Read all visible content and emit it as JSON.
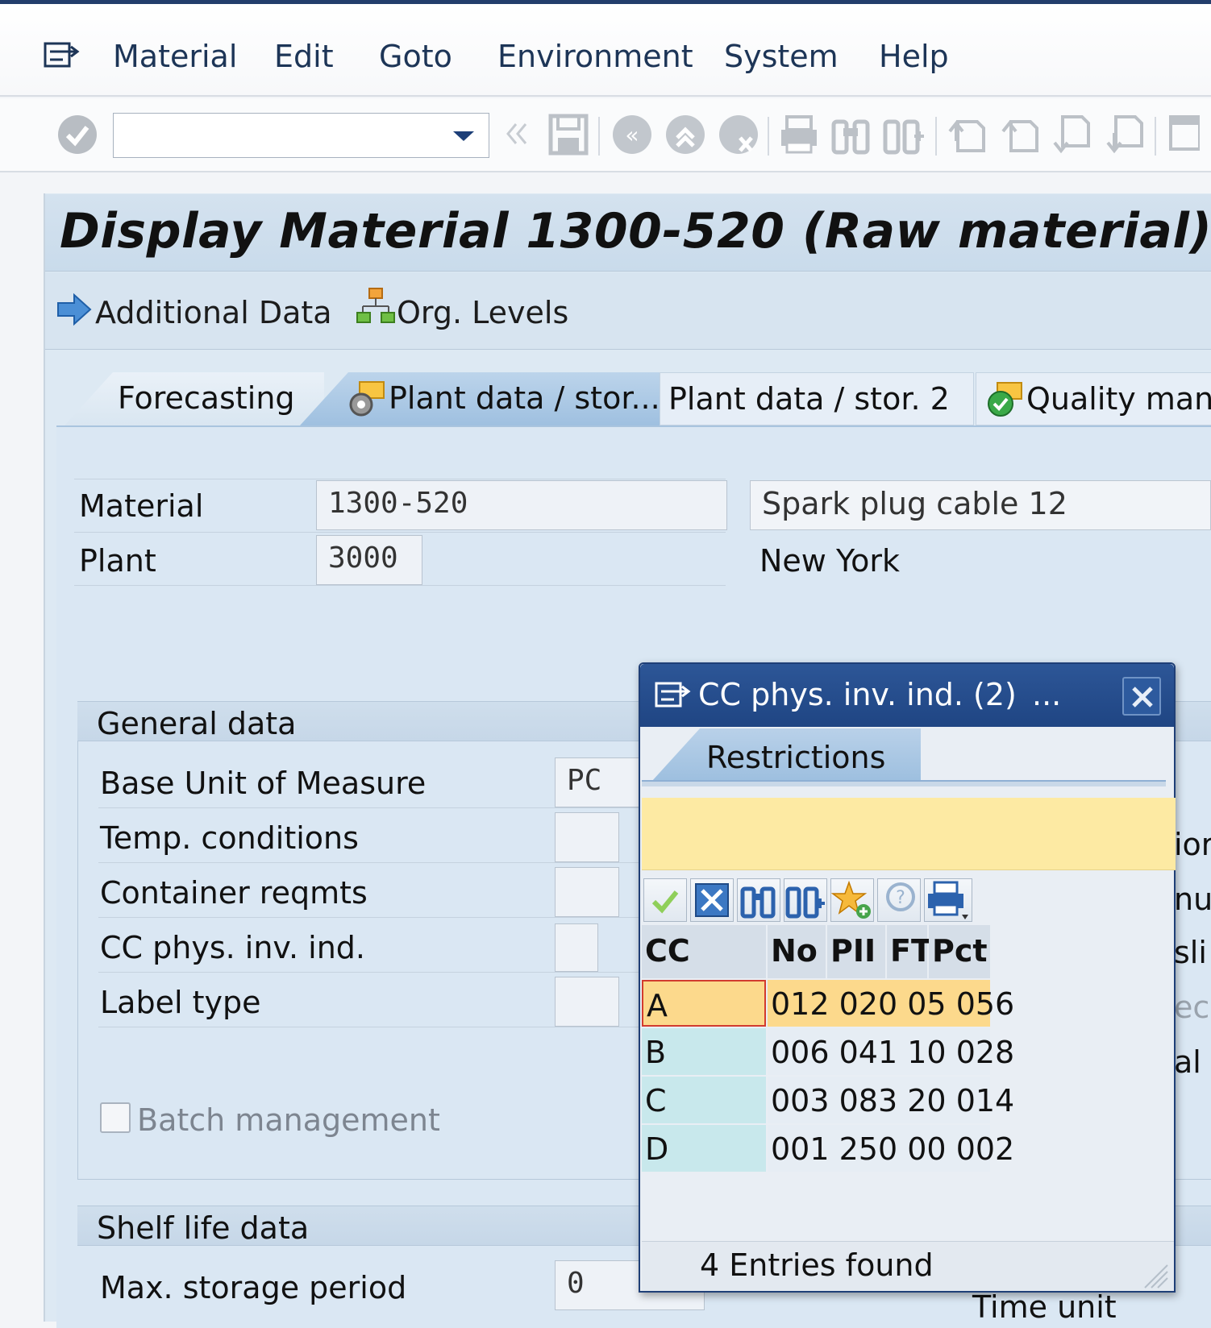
{
  "menubar": {
    "items": [
      {
        "label": "Material"
      },
      {
        "label": "Edit"
      },
      {
        "label": "Goto"
      },
      {
        "label": "Environment"
      },
      {
        "label": "System"
      },
      {
        "label": "Help"
      }
    ]
  },
  "toolbar": {
    "command_field_value": "",
    "icons": [
      "enter-check-icon",
      "back-icon",
      "save-icon",
      "back-nav-icon",
      "exit-icon",
      "cancel-icon",
      "print-icon",
      "find-icon",
      "find-next-icon",
      "first-page-icon",
      "previous-page-icon",
      "next-page-icon",
      "last-page-icon",
      "new-session-icon"
    ]
  },
  "header": {
    "title": "Display Material 1300-520 (Raw material)"
  },
  "app_toolbar": {
    "additional_data": "Additional Data",
    "org_levels": "Org. Levels"
  },
  "tabs": {
    "forecasting": "Forecasting",
    "plant_data_1": "Plant data / stor...",
    "plant_data_2": "Plant data / stor. 2",
    "quality": "Quality mana"
  },
  "material": {
    "material_label": "Material",
    "material_value": "1300-520",
    "material_desc": "Spark plug cable 12",
    "plant_label": "Plant",
    "plant_value": "3000",
    "plant_desc": "New York"
  },
  "general_data": {
    "header": "General data",
    "fields": {
      "base_uom_label": "Base Unit of Measure",
      "base_uom_value": "PC",
      "temp_label": "Temp. conditions",
      "temp_value": "",
      "container_label": "Container reqmts",
      "container_value": "",
      "cc_label": "CC phys. inv. ind.",
      "cc_value": "",
      "label_type_label": "Label type",
      "label_type_value": ""
    },
    "batch_label": "Batch management",
    "batch_checked": false
  },
  "shelf_life": {
    "header": "Shelf life data",
    "max_storage_label": "Max. storage period",
    "max_storage_value": "0",
    "time_unit_label": "Time unit"
  },
  "right_peek": {
    "r1": "ior",
    "r2": "nu",
    "r3": "sli",
    "r4": "ec",
    "r5": "al"
  },
  "popup": {
    "title": "CC phys. inv. ind. (2)",
    "more": "...",
    "tab": "Restrictions",
    "columns": [
      "CC",
      "No",
      "PII",
      "FT",
      "Pct"
    ],
    "rows": [
      {
        "cc": "A",
        "no": "012",
        "pii": "020",
        "ft": "05",
        "pct": "056"
      },
      {
        "cc": "B",
        "no": "006",
        "pii": "041",
        "ft": "10",
        "pct": "028"
      },
      {
        "cc": "C",
        "no": "003",
        "pii": "083",
        "ft": "20",
        "pct": "014"
      },
      {
        "cc": "D",
        "no": "001",
        "pii": "250",
        "ft": "00",
        "pct": "002"
      }
    ],
    "status": "4 Entries found"
  }
}
